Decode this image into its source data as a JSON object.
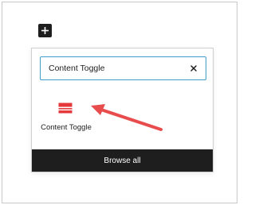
{
  "inserter": {
    "search": {
      "value": "Content Toggle",
      "clear_icon": "close-icon"
    },
    "results": [
      {
        "label": "Content Toggle",
        "icon": "content-toggle-icon"
      }
    ],
    "browse_all_label": "Browse all"
  },
  "toolbar": {
    "add_block_icon": "plus-icon"
  },
  "colors": {
    "accent": "#3e9ec9",
    "dark": "#1e1e1e",
    "block_icon": "#e5383b",
    "arrow": "#e84c4c"
  }
}
